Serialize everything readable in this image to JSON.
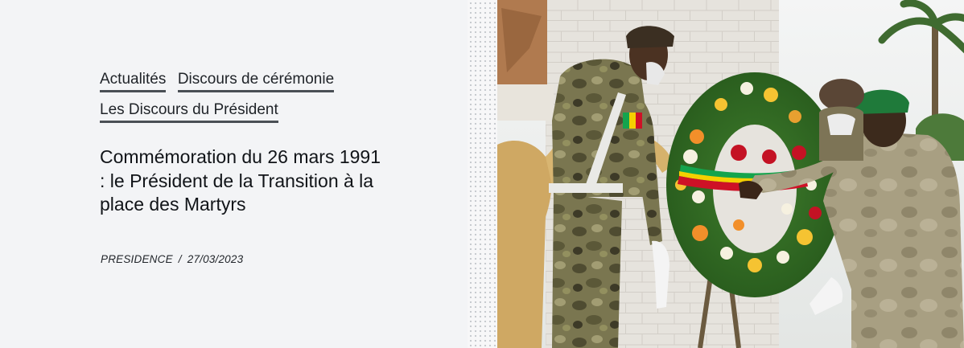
{
  "categories": [
    {
      "label": "Actualités"
    },
    {
      "label": "Discours de cérémonie"
    },
    {
      "label": "Les Discours du Président"
    }
  ],
  "article": {
    "title": "Commémoration du 26 mars 1991 : le Président de la Transition à la place des Martyrs",
    "author": "PRESIDENCE",
    "separator": "/",
    "date": "27/03/2023"
  },
  "colors": {
    "background": "#f3f4f6",
    "text": "#111418",
    "underline": "#4a4f55",
    "camo": "#6b6a44",
    "flag_green": "#14a44d",
    "flag_yellow": "#f5d000",
    "flag_red": "#ce1126"
  },
  "photo": {
    "icon": "photo-image"
  }
}
